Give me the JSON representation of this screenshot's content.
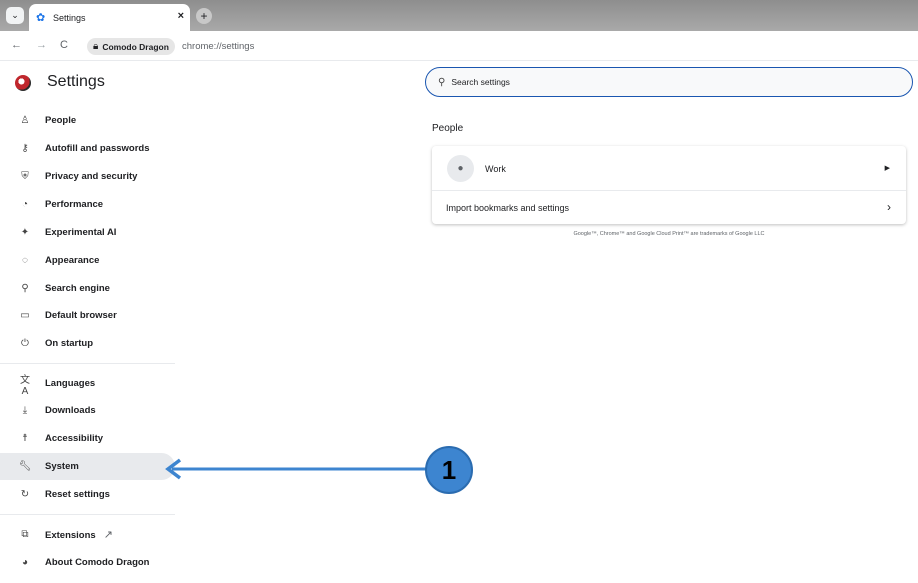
{
  "browser": {
    "tab_title": "Settings",
    "tab_close": "×",
    "new_tab": "+",
    "site_name": "Comodo Dragon",
    "url": "chrome://settings"
  },
  "sidebar": {
    "app_title": "Settings",
    "items": [
      {
        "label": "People",
        "icon": "person-icon"
      },
      {
        "label": "Autofill and passwords",
        "icon": "key-icon"
      },
      {
        "label": "Privacy and security",
        "icon": "shield-icon"
      },
      {
        "label": "Performance",
        "icon": "speedometer-icon"
      },
      {
        "label": "Experimental AI",
        "icon": "sparkle-icon"
      },
      {
        "label": "Appearance",
        "icon": "palette-icon"
      },
      {
        "label": "Search engine",
        "icon": "search-icon"
      },
      {
        "label": "Default browser",
        "icon": "browser-window-icon"
      },
      {
        "label": "On startup",
        "icon": "power-icon"
      },
      {
        "label": "Languages",
        "icon": "translate-icon"
      },
      {
        "label": "Downloads",
        "icon": "download-icon"
      },
      {
        "label": "Accessibility",
        "icon": "accessibility-icon"
      },
      {
        "label": "System",
        "icon": "wrench-icon"
      },
      {
        "label": "Reset settings",
        "icon": "reset-icon"
      },
      {
        "label": "Extensions",
        "icon": "puzzle-icon"
      },
      {
        "label": "About Comodo Dragon",
        "icon": "dragon-logo-icon"
      }
    ],
    "active_item": "System"
  },
  "main": {
    "search_placeholder": "Search settings",
    "section_title": "People",
    "profile_name": "Work",
    "import_label": "Import bookmarks and settings",
    "footnote": "Google™, Chrome™ and Google Cloud Print™ are trademarks of Google LLC"
  },
  "annotation": {
    "step_number": "1",
    "color": "#3d85d0"
  }
}
